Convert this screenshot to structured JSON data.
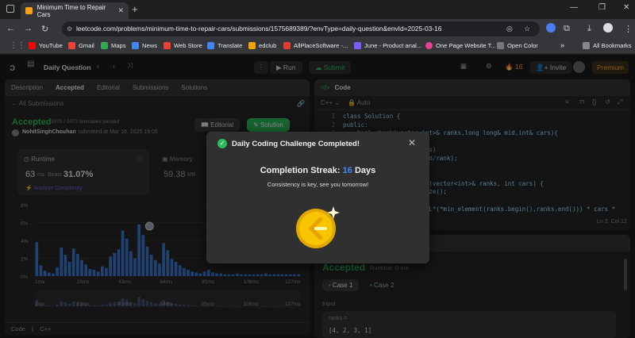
{
  "browser": {
    "tab_title": "Minimum Time to Repair Cars",
    "url": "leetcode.com/problems/minimum-time-to-repair-cars/submissions/1575689389/?envType=daily-question&envId=2025-03-16",
    "bookmarks": [
      "YouTube",
      "Gmail",
      "Maps",
      "News",
      "Web Store",
      "Translate",
      "edclub",
      "AllPlaceSoftware -...",
      "June - Product anal...",
      "One Page Website T...",
      "Open Color"
    ],
    "all_bookmarks": "All Bookmarks"
  },
  "nav": {
    "daily_question": "Daily Question",
    "run": "Run",
    "submit": "Submit",
    "streak_count": "16",
    "invite": "Invite",
    "premium": "Premium"
  },
  "left_panel": {
    "tabs": [
      "Description",
      "Accepted",
      "Editorial",
      "Submissions",
      "Solutions"
    ],
    "all_submissions": "All Submissions",
    "status": "Accepted",
    "testcases": "1072 / 1072 testcases passed",
    "user": "NohitSinghChouhan",
    "submitted": "submitted at Mar 16, 2025 19:05",
    "editorial_btn": "Editorial",
    "solution_btn": "Solution",
    "runtime_label": "Runtime",
    "runtime_value": "63",
    "runtime_unit": "ms",
    "beats_label": "Beats",
    "beats_value": "31.07%",
    "memory_label": "Memory",
    "memory_value": "59.38",
    "memory_unit": "MB",
    "analyze": "Analyze Complexity",
    "footer_code": "Code",
    "footer_lang": "C++"
  },
  "chart_data": {
    "type": "bar",
    "ylabels": [
      "8%",
      "6%",
      "4%",
      "2%",
      "0%"
    ],
    "xlabels": [
      "1ms",
      "23ms",
      "43ms",
      "64ms",
      "85ms",
      "106ms",
      "127ms"
    ],
    "ylim": [
      0,
      8
    ],
    "marker_x_label": "64ms",
    "values": [
      3.8,
      1.2,
      0.6,
      0.4,
      0.3,
      1.0,
      3.2,
      2.4,
      1.6,
      3.1,
      2.5,
      1.8,
      1.3,
      0.8,
      0.7,
      0.5,
      1.1,
      0.9,
      2.2,
      2.6,
      3.0,
      5.1,
      4.2,
      2.8,
      2.0,
      5.8,
      4.6,
      3.3,
      2.4,
      1.8,
      1.4,
      3.7,
      2.9,
      1.9,
      1.6,
      1.2,
      0.9,
      0.7,
      0.5,
      0.4,
      0.3,
      0.5,
      0.7,
      0.4,
      0.3,
      0.3,
      0.2,
      0.2,
      0.2,
      0.3,
      0.2,
      0.2,
      0.2,
      0.2,
      0.2,
      0.2,
      0.3,
      0.2,
      0.2,
      0.2,
      0.2,
      0.2,
      0.2,
      0.2,
      0.2
    ]
  },
  "right_panel": {
    "code_tab": "Code",
    "lang": "C++",
    "auto": "Auto",
    "code_lines": [
      {
        "n": "1",
        "t": "class Solution {"
      },
      {
        "n": "2",
        "t": "public:"
      },
      {
        "n": "3",
        "t": "    bool check(vector<int>& ranks,long long& mid,int& cars){"
      },
      {
        "n": "4",
        "t": ""
      },
      {
        "n": "5",
        "t": "        for(int r : ranks)"
      },
      {
        "n": "6",
        "t": "            c += sqrt(mid/rank);"
      },
      {
        "n": "7",
        "t": ""
      },
      {
        "n": "8",
        "t": "    }"
      },
      {
        "n": "9",
        "t": "    long long repairCars(vector<int>& ranks, int cars) {"
      },
      {
        "n": "10",
        "t": "        int n = ranks.size();"
      },
      {
        "n": "11",
        "t": ""
      },
      {
        "n": "12",
        "t": "        long long r = 1LL*(*min_element(ranks.begin(),ranks.end())) * cars *"
      }
    ],
    "cursor_pos": "Ln 2, Col 12",
    "result_status": "Accepted",
    "result_runtime": "Runtime: 0 ms",
    "case1": "Case 1",
    "case2": "Case 2",
    "input_label": "Input",
    "ranks_label": "ranks =",
    "ranks_value": "[4, 2, 3, 1]"
  },
  "modal": {
    "title": "Daily Coding Challenge Completed!",
    "streak_label": "Completion Streak:",
    "streak_value": "16",
    "streak_unit": "Days",
    "message": "Consistency is key, see you tomorrow!"
  },
  "colors": {
    "accent": "#ffa116",
    "green": "#2cbb5d",
    "blue": "#3e88f7",
    "bar": "#3b78d1"
  }
}
